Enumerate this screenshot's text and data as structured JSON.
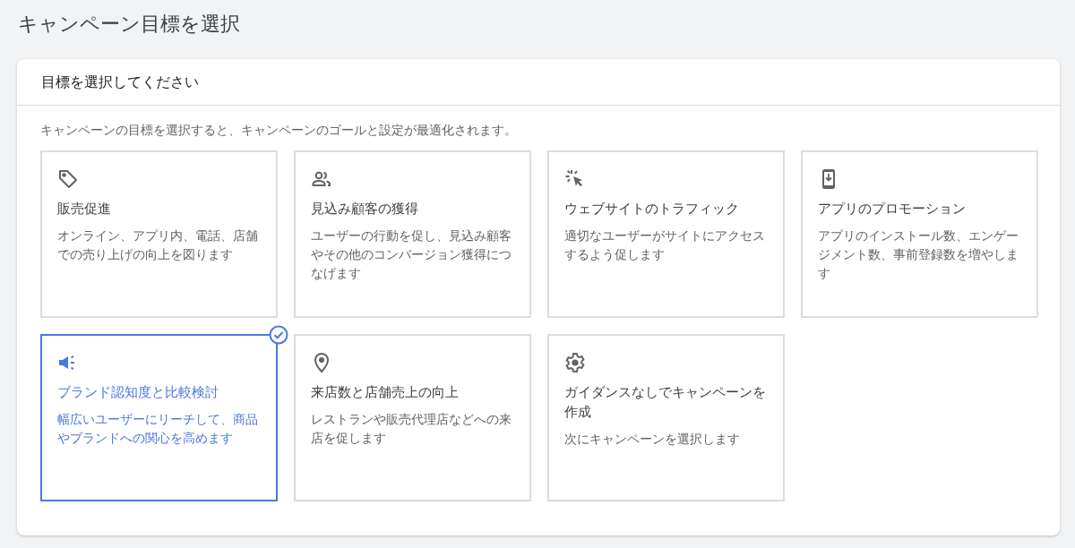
{
  "page_title": "キャンペーン目標を選択",
  "panel": {
    "header": "目標を選択してください",
    "description": "キャンペーンの目標を選択すると、キャンペーンのゴールと設定が最適化されます。"
  },
  "goals": [
    {
      "kind": "tag",
      "title": "販売促進",
      "description": "オンライン、アプリ内、電話、店舗での売り上げの向上を図ります",
      "selected": false
    },
    {
      "kind": "people",
      "title": "見込み顧客の獲得",
      "description": "ユーザーの行動を促し、見込み顧客やその他のコンバージョン獲得につなげます",
      "selected": false
    },
    {
      "kind": "click",
      "title": "ウェブサイトのトラフィック",
      "description": "適切なユーザーがサイトにアクセスするよう促します",
      "selected": false
    },
    {
      "kind": "phone",
      "title": "アプリのプロモーション",
      "description": "アプリのインストール数、エンゲージメント数、事前登録数を増やします",
      "selected": false
    },
    {
      "kind": "megaphone",
      "title": "ブランド認知度と比較検討",
      "description": "幅広いユーザーにリーチして、商品やブランドへの関心を高めます",
      "selected": true
    },
    {
      "kind": "pin",
      "title": "来店数と店舗売上の向上",
      "description": "レストランや販売代理店などへの来店を促します",
      "selected": false
    },
    {
      "kind": "gear",
      "title": "ガイダンスなしでキャンペーンを作成",
      "description": "次にキャンペーンを選択します",
      "selected": false
    }
  ]
}
